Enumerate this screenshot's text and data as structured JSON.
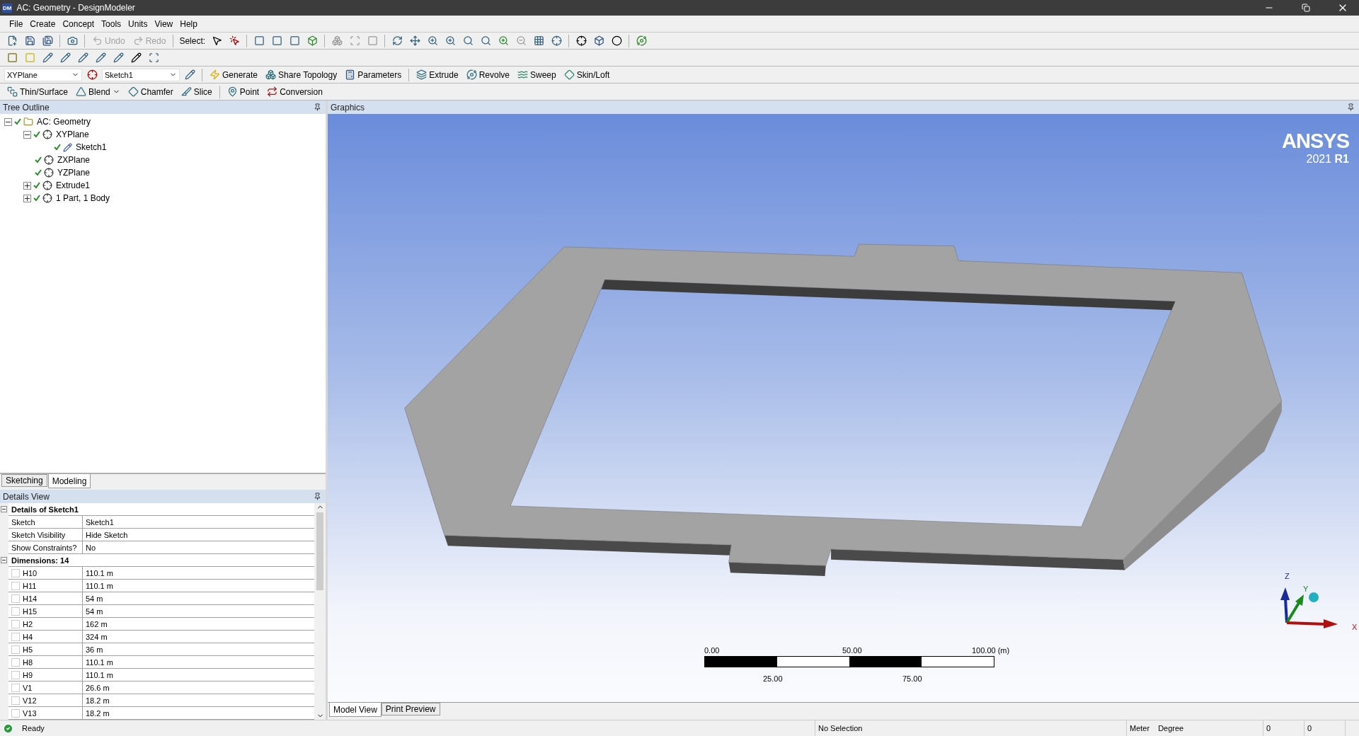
{
  "window": {
    "title": "AC: Geometry - DesignModeler",
    "app_badge": "DM"
  },
  "menu": [
    "File",
    "Create",
    "Concept",
    "Tools",
    "Units",
    "View",
    "Help"
  ],
  "standard_toolbar": {
    "undo": {
      "label": "Undo",
      "disabled": true
    },
    "redo": {
      "label": "Redo",
      "disabled": true
    },
    "select_label": "Select:"
  },
  "features_toolbar": {
    "plane_combo": "XYPlane",
    "sketch_combo": "Sketch1",
    "buttons": [
      {
        "label": "Generate",
        "dropdown": false
      },
      {
        "label": "Share Topology",
        "dropdown": false
      },
      {
        "label": "Parameters",
        "dropdown": false
      },
      {
        "label": "Extrude",
        "dropdown": false
      },
      {
        "label": "Revolve",
        "dropdown": false
      },
      {
        "label": "Sweep",
        "dropdown": false
      },
      {
        "label": "Skin/Loft",
        "dropdown": false
      }
    ]
  },
  "operations_toolbar": {
    "buttons": [
      {
        "label": "Thin/Surface",
        "dropdown": false
      },
      {
        "label": "Blend",
        "dropdown": true
      },
      {
        "label": "Chamfer",
        "dropdown": false
      },
      {
        "label": "Slice",
        "dropdown": false
      },
      {
        "label": "Point",
        "dropdown": false
      },
      {
        "label": "Conversion",
        "dropdown": false
      }
    ]
  },
  "tree_outline": {
    "title": "Tree Outline",
    "items": [
      {
        "label": "AC: Geometry",
        "expanded": true,
        "children": [
          {
            "label": "XYPlane",
            "expanded": true,
            "children": [
              {
                "label": "Sketch1"
              }
            ]
          },
          {
            "label": "ZXPlane"
          },
          {
            "label": "YZPlane"
          },
          {
            "label": "Extrude1",
            "expanded": false
          },
          {
            "label": "1 Part, 1 Body",
            "expanded": false
          }
        ]
      }
    ]
  },
  "mode_tabs": [
    {
      "label": "Sketching",
      "selected": false
    },
    {
      "label": "Modeling",
      "selected": true
    }
  ],
  "details_view": {
    "title": "Details View",
    "sections": [
      {
        "title": "Details of Sketch1",
        "expanded": true,
        "rows": [
          {
            "name": "Sketch",
            "value": "Sketch1"
          },
          {
            "name": "Sketch Visibility",
            "value": "Hide Sketch"
          },
          {
            "name": "Show Constraints?",
            "value": "No"
          }
        ]
      },
      {
        "title": "Dimensions: 14",
        "expanded": true,
        "rows": [
          {
            "name": "H10",
            "value": "110.1 m",
            "checked": false
          },
          {
            "name": "H11",
            "value": "110.1 m",
            "checked": false
          },
          {
            "name": "H14",
            "value": "54 m",
            "checked": false
          },
          {
            "name": "H15",
            "value": "54 m",
            "checked": false
          },
          {
            "name": "H2",
            "value": "162 m",
            "checked": false
          },
          {
            "name": "H4",
            "value": "324 m",
            "checked": false
          },
          {
            "name": "H5",
            "value": "36 m",
            "checked": false
          },
          {
            "name": "H8",
            "value": "110.1 m",
            "checked": false
          },
          {
            "name": "H9",
            "value": "110.1 m",
            "checked": false
          },
          {
            "name": "V1",
            "value": "26.6 m",
            "checked": false
          },
          {
            "name": "V12",
            "value": "18.2 m",
            "checked": false
          },
          {
            "name": "V13",
            "value": "18.2 m",
            "checked": false
          }
        ]
      }
    ]
  },
  "graphics": {
    "title": "Graphics",
    "logo": {
      "name": "ANSYS",
      "version": "2021",
      "release": "R1"
    },
    "scale_bar": {
      "top_labels": [
        "0.00",
        "50.00",
        "100.00 (m)"
      ],
      "bottom_labels": [
        "25.00",
        "75.00"
      ]
    },
    "axes": {
      "z": "Z",
      "y": "Y",
      "x": "X"
    }
  },
  "view_tabs": [
    {
      "label": "Model View",
      "selected": true
    },
    {
      "label": "Print Preview",
      "selected": false
    }
  ],
  "status_bar": {
    "message": "Ready",
    "selection": "No Selection",
    "length_unit": "Meter",
    "angle_unit": "Degree",
    "field_1": "0",
    "field_2": "0"
  }
}
